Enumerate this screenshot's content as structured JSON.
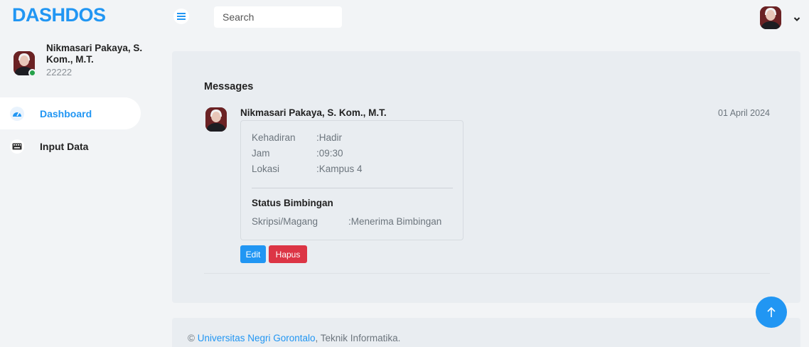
{
  "brand": {
    "name": "DASHDOS"
  },
  "user": {
    "name": "Nikmasari Pakaya, S. Kom., M.T.",
    "id": "22222"
  },
  "sidebar": {
    "items": [
      {
        "label": "Dashboard",
        "icon": "gauge-icon",
        "active": true
      },
      {
        "label": "Input Data",
        "icon": "keyboard-icon",
        "active": false
      }
    ]
  },
  "topbar": {
    "search_placeholder": "Search"
  },
  "messages": {
    "title": "Messages",
    "items": [
      {
        "sender": "Nikmasari Pakaya, S. Kom., M.T.",
        "date": "01 April 2024",
        "details": [
          {
            "key": "Kehadiran",
            "value": ":Hadir"
          },
          {
            "key": "Jam",
            "value": ":09:30"
          },
          {
            "key": "Lokasi",
            "value": ":Kampus 4"
          }
        ],
        "status_title": "Status Bimbingan",
        "status": {
          "key": "Skripsi/Magang",
          "value": ":Menerima Bimbingan"
        },
        "edit_label": "Edit",
        "delete_label": "Hapus"
      }
    ]
  },
  "footer": {
    "prefix": "© ",
    "link": "Universitas Negri Gorontalo",
    "suffix": ", Teknik Informatika."
  },
  "colors": {
    "accent": "#2196f3",
    "danger": "#dc3545",
    "online": "#26a24a"
  }
}
